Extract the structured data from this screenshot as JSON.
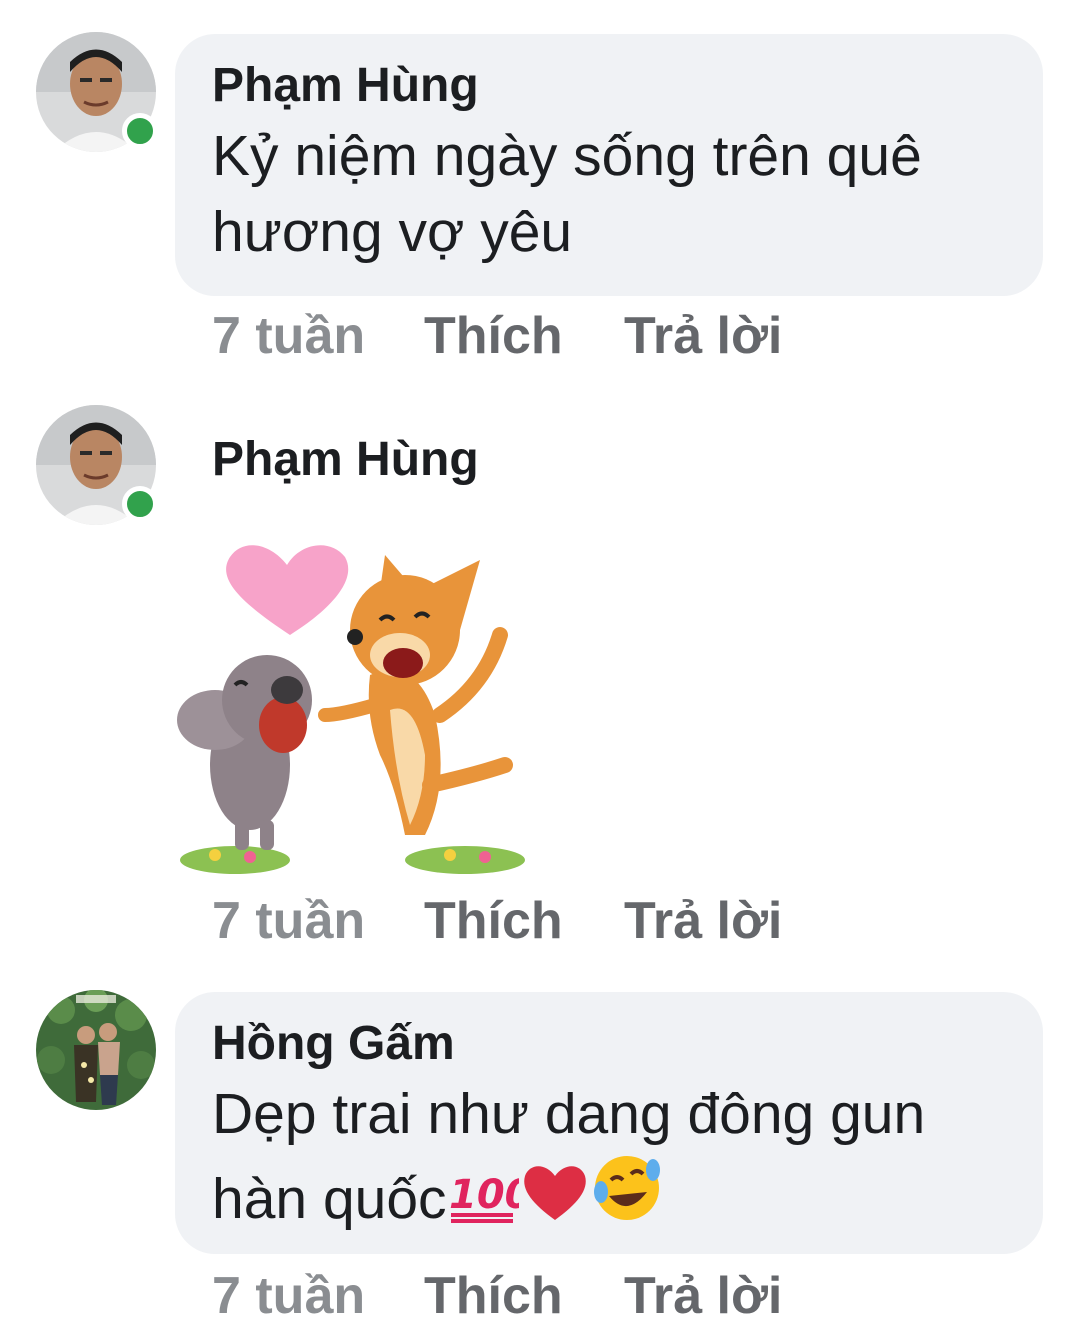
{
  "comments": [
    {
      "author": "Phạm Hùng",
      "text_line1": "Kỷ niệm ngày sống trên quê",
      "text_line2": "hương vợ yêu",
      "time": "7 tuần",
      "like_label": "Thích",
      "reply_label": "Trả lời",
      "avatar_icon": "user-photo",
      "online": true
    },
    {
      "author": "Phạm Hùng",
      "sticker_icon": "mouse-and-corgi-dancing-heart-sticker",
      "time": "7 tuần",
      "like_label": "Thích",
      "reply_label": "Trả lời",
      "avatar_icon": "user-photo",
      "online": true
    },
    {
      "author": "Hồng Gấm",
      "text_line1": "Dẹp trai như dang đông gun",
      "text_line2": "hàn quốc",
      "emojis": [
        "hundred-points-emoji",
        "red-heart-emoji",
        "rolling-laughing-emoji"
      ],
      "time": "7 tuần",
      "like_label": "Thích",
      "reply_label": "Trả lời",
      "avatar_icon": "couple-photo",
      "online": false
    }
  ],
  "colors": {
    "bubble": "#f0f2f5",
    "online": "#31a24c",
    "secondary_text": "#65676b"
  }
}
